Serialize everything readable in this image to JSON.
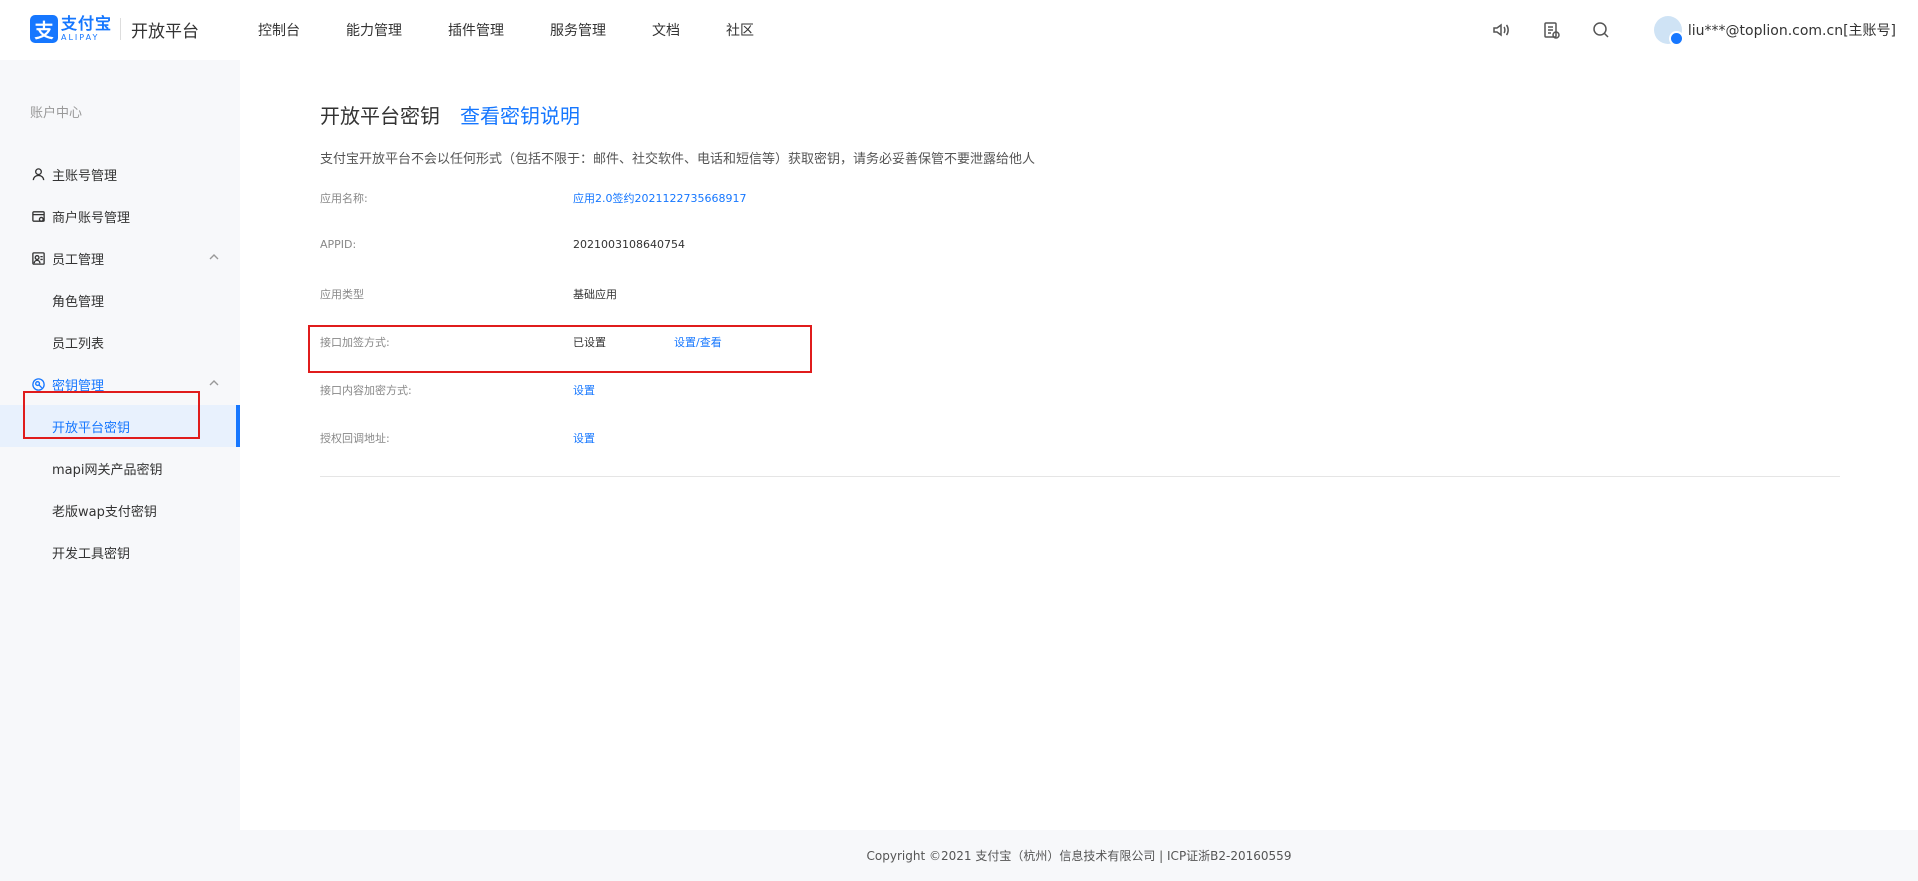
{
  "header": {
    "logo": {
      "mark": "支",
      "cn": "支付宝",
      "en": "ALIPAY",
      "platform": "开放平台"
    },
    "nav": [
      "控制台",
      "能力管理",
      "插件管理",
      "服务管理",
      "文档",
      "社区"
    ],
    "icons": [
      "speaker-icon",
      "document-icon",
      "search-icon"
    ],
    "user_email": "liu***@toplion.com.cn[主账号]"
  },
  "sidebar": {
    "group_title": "账户中心",
    "items": [
      {
        "label": "主账号管理",
        "icon": "user-icon"
      },
      {
        "label": "商户账号管理",
        "icon": "shop-icon"
      },
      {
        "label": "员工管理",
        "icon": "staff-icon",
        "expanded": true
      },
      {
        "label": "角色管理"
      },
      {
        "label": "员工列表"
      },
      {
        "label": "密钥管理",
        "icon": "key-icon",
        "expanded": true
      },
      {
        "label": "开放平台密钥",
        "active": true
      },
      {
        "label": "mapi网关产品密钥"
      },
      {
        "label": "老版wap支付密钥"
      },
      {
        "label": "开发工具密钥"
      }
    ]
  },
  "main": {
    "title": "开放平台密钥",
    "title_link": "查看密钥说明",
    "notice": "支付宝开放平台不会以任何形式（包括不限于：邮件、社交软件、电话和短信等）获取密钥，请务必妥善保管不要泄露给他人",
    "rows": [
      {
        "label": "应用名称:",
        "value": "应用2.0签约2021122735668917"
      },
      {
        "label": "APPID:",
        "value": "2021003108640754"
      },
      {
        "label": "应用类型",
        "value": "基础应用"
      },
      {
        "label": "接口加签方式:",
        "value": "已设置",
        "action": "设置/查看"
      },
      {
        "label": "接口内容加密方式:",
        "value": "设置"
      },
      {
        "label": "授权回调地址:",
        "value": "设置"
      }
    ]
  },
  "footer": {
    "text": "Copyright ©2021 支付宝（杭州）信息技术有限公司  |  ICP证浙B2-20160559"
  },
  "colors": {
    "accent": "#1677ff",
    "highlight": "#e01c1c"
  }
}
